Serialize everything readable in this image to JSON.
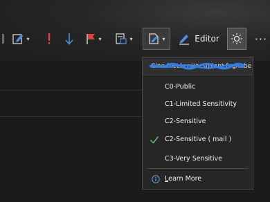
{
  "ribbon": {
    "editor_label": "Editor",
    "more_label": "···",
    "icons": [
      "pen-icon",
      "importance-icon",
      "down-arrow-icon",
      "flag-icon",
      "template-icon",
      "sensitivity-icon",
      "editor-icon",
      "light-icon",
      "more-icon"
    ]
  },
  "sensitivity_menu": {
    "account": "Cine Blecker@testplant.fagnabe",
    "items": [
      {
        "label": "C0-Public",
        "checked": false
      },
      {
        "label": "C1-Limited Sensitivity",
        "checked": false
      },
      {
        "label": "C2-Sensitive",
        "checked": false
      },
      {
        "label": "C2-Sensitive ( mail )",
        "checked": true
      },
      {
        "label": "C3-Very Sensitive",
        "checked": false
      }
    ],
    "learn_more_prefix": "L",
    "learn_more_rest": "earn More"
  },
  "colors": {
    "background": "#1b1b1b",
    "menu_bg": "#262626",
    "accent_blue": "#4a8fe0",
    "flag_red": "#e0403a",
    "scribble_blue": "#2f7fe8",
    "check_green": "#6fb56f"
  }
}
